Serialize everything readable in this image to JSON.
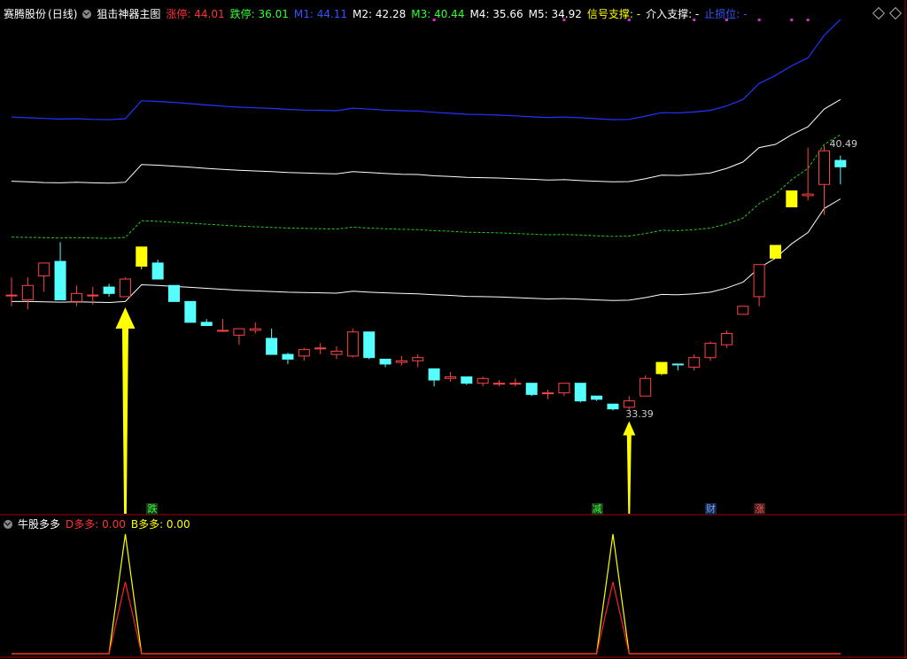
{
  "header": {
    "stock": "赛腾股份",
    "period": "(日线)",
    "indicator": "狙击神器主图",
    "items": [
      {
        "label": "涨停: 44.01",
        "color": "#ff3333"
      },
      {
        "label": "跌停: 36.01",
        "color": "#33ff33"
      },
      {
        "label": "M1: 44.11",
        "color": "#3355ff"
      },
      {
        "label": "M2: 42.28",
        "color": "#ffffff"
      },
      {
        "label": "M3: 40.44",
        "color": "#33ff33"
      },
      {
        "label": "M4: 35.66",
        "color": "#ffffff"
      },
      {
        "label": "M5: 34.92",
        "color": "#ffffff"
      },
      {
        "label": "信号支撑: -",
        "color": "#ffff00"
      },
      {
        "label": "介入支撑: -",
        "color": "#ffffff"
      },
      {
        "label": "止损位: -",
        "color": "#3355ff"
      }
    ]
  },
  "sub_header": {
    "name": "牛股多多",
    "items": [
      {
        "label": "D多多: 0.00",
        "color": "#ff3333"
      },
      {
        "label": "B多多: 0.00",
        "color": "#ffff00"
      }
    ]
  },
  "price_labels": {
    "high": "40.49",
    "low": "33.39"
  },
  "signal_tags": [
    {
      "text": "跌",
      "color": "#33ff33",
      "bg": "#1a3a1a",
      "candle": 7
    },
    {
      "text": "减",
      "color": "#33ff33",
      "bg": "#1a3a1a",
      "candle": 36
    },
    {
      "text": "财",
      "color": "#66aaff",
      "bg": "#1a2244",
      "candle": 43
    },
    {
      "text": "涨",
      "color": "#ff5555",
      "bg": "#3a1a1a",
      "candle": 46
    }
  ],
  "arrows": [
    {
      "candle": 7
    },
    {
      "candle": 38
    }
  ],
  "colors": {
    "up": "#ff4444",
    "down": "#55ffff",
    "signal": "#ffff00",
    "m1": "#2233ff",
    "band": "#ffffff",
    "m3": "#22cc22",
    "sub_b": "#ffff00",
    "sub_d": "#ff2222",
    "border": "#aa0000"
  },
  "chart_data": [
    {
      "type": "candlestick",
      "title": "狙击神器主图",
      "ylim": [
        33,
        48
      ],
      "candles": [
        {
          "o": 39.35,
          "h": 39.9,
          "l": 39.0,
          "c": 39.35
        },
        {
          "o": 39.2,
          "h": 39.9,
          "l": 38.9,
          "c": 39.65
        },
        {
          "o": 39.95,
          "h": 40.35,
          "l": 39.45,
          "c": 40.35
        },
        {
          "o": 40.4,
          "h": 41.0,
          "l": 39.2,
          "c": 39.2,
          "x": 1
        },
        {
          "o": 39.15,
          "h": 39.65,
          "l": 39.0,
          "c": 39.4
        },
        {
          "o": 39.35,
          "h": 39.6,
          "l": 39.05,
          "c": 39.35
        },
        {
          "o": 39.4,
          "h": 39.7,
          "l": 39.3,
          "c": 39.6,
          "x": 1
        },
        {
          "o": 39.3,
          "h": 39.9,
          "l": 39.3,
          "c": 39.85
        },
        {
          "o": 40.85,
          "h": 40.85,
          "l": 40.15,
          "c": 40.25,
          "y": 1
        },
        {
          "o": 40.35,
          "h": 40.45,
          "l": 39.85,
          "c": 39.85,
          "x": 1
        },
        {
          "o": 39.65,
          "h": 39.65,
          "l": 39.15,
          "c": 39.15,
          "x": 1
        },
        {
          "o": 39.15,
          "h": 39.15,
          "l": 38.5,
          "c": 38.5,
          "x": 1
        },
        {
          "o": 38.5,
          "h": 38.6,
          "l": 38.4,
          "c": 38.4,
          "x": 1
        },
        {
          "o": 38.25,
          "h": 38.6,
          "l": 38.2,
          "c": 38.25
        },
        {
          "o": 38.1,
          "h": 38.3,
          "l": 37.8,
          "c": 38.3
        },
        {
          "o": 38.3,
          "h": 38.5,
          "l": 38.15,
          "c": 38.25
        },
        {
          "o": 38.0,
          "h": 38.3,
          "l": 37.5,
          "c": 37.5,
          "x": 1
        },
        {
          "o": 37.5,
          "h": 37.55,
          "l": 37.2,
          "c": 37.35,
          "x": 1
        },
        {
          "o": 37.45,
          "h": 37.7,
          "l": 37.3,
          "c": 37.65
        },
        {
          "o": 37.7,
          "h": 37.85,
          "l": 37.5,
          "c": 37.7
        },
        {
          "o": 37.5,
          "h": 37.75,
          "l": 37.35,
          "c": 37.6
        },
        {
          "o": 37.45,
          "h": 38.3,
          "l": 37.4,
          "c": 38.2
        },
        {
          "o": 38.2,
          "h": 38.2,
          "l": 37.35,
          "c": 37.4,
          "x": 1
        },
        {
          "o": 37.35,
          "h": 37.35,
          "l": 37.1,
          "c": 37.2,
          "x": 1
        },
        {
          "o": 37.25,
          "h": 37.45,
          "l": 37.15,
          "c": 37.3
        },
        {
          "o": 37.3,
          "h": 37.5,
          "l": 37.1,
          "c": 37.4
        },
        {
          "o": 37.05,
          "h": 37.05,
          "l": 36.5,
          "c": 36.7,
          "x": 1
        },
        {
          "o": 36.75,
          "h": 36.95,
          "l": 36.65,
          "c": 36.8
        },
        {
          "o": 36.8,
          "h": 36.8,
          "l": 36.55,
          "c": 36.6,
          "x": 1
        },
        {
          "o": 36.6,
          "h": 36.8,
          "l": 36.5,
          "c": 36.75
        },
        {
          "o": 36.6,
          "h": 36.7,
          "l": 36.5,
          "c": 36.6
        },
        {
          "o": 36.6,
          "h": 36.75,
          "l": 36.5,
          "c": 36.6
        },
        {
          "o": 36.6,
          "h": 36.6,
          "l": 36.2,
          "c": 36.25,
          "x": 1
        },
        {
          "o": 36.3,
          "h": 36.4,
          "l": 36.1,
          "c": 36.3
        },
        {
          "o": 36.3,
          "h": 36.6,
          "l": 36.2,
          "c": 36.6
        },
        {
          "o": 36.6,
          "h": 36.6,
          "l": 36.0,
          "c": 36.05,
          "x": 1
        },
        {
          "o": 36.2,
          "h": 36.2,
          "l": 36.05,
          "c": 36.1,
          "x": 1
        },
        {
          "o": 35.95,
          "h": 35.95,
          "l": 35.75,
          "c": 35.8,
          "x": 1
        },
        {
          "o": 35.85,
          "h": 36.2,
          "l": 35.75,
          "c": 36.05
        },
        {
          "o": 36.2,
          "h": 36.85,
          "l": 36.2,
          "c": 36.75
        },
        {
          "o": 37.25,
          "h": 37.25,
          "l": 36.85,
          "c": 36.9,
          "y": 1
        },
        {
          "o": 37.2,
          "h": 37.2,
          "l": 37.0,
          "c": 37.2,
          "x": 1
        },
        {
          "o": 37.1,
          "h": 37.5,
          "l": 37.0,
          "c": 37.4
        },
        {
          "o": 37.4,
          "h": 37.9,
          "l": 37.3,
          "c": 37.85
        },
        {
          "o": 37.8,
          "h": 38.25,
          "l": 37.7,
          "c": 38.15
        },
        {
          "o": 38.75,
          "h": 39.0,
          "l": 38.75,
          "c": 39.0
        },
        {
          "o": 39.3,
          "h": 40.3,
          "l": 39.0,
          "c": 40.3
        },
        {
          "o": 40.9,
          "h": 40.9,
          "l": 40.5,
          "c": 40.5,
          "y": 1
        },
        {
          "o": 42.6,
          "h": 42.6,
          "l": 42.1,
          "c": 42.1,
          "y": 1
        },
        {
          "o": 42.45,
          "h": 43.95,
          "l": 42.3,
          "c": 42.5
        },
        {
          "o": 42.8,
          "h": 44.01,
          "l": 41.85,
          "c": 43.85
        },
        {
          "o": 43.55,
          "h": 43.7,
          "l": 42.8,
          "c": 43.35,
          "x": 1
        }
      ],
      "series": [
        {
          "name": "M1",
          "values": [
            44.9,
            44.88,
            44.86,
            44.84,
            44.85,
            44.83,
            44.82,
            44.85,
            45.41,
            45.39,
            45.36,
            45.32,
            45.28,
            45.24,
            45.21,
            45.19,
            45.17,
            45.14,
            45.12,
            45.11,
            45.1,
            45.18,
            45.15,
            45.12,
            45.1,
            45.09,
            45.05,
            45.02,
            44.99,
            44.98,
            44.96,
            44.94,
            44.91,
            44.89,
            44.9,
            44.88,
            44.85,
            44.82,
            44.83,
            44.93,
            45.04,
            45.03,
            45.06,
            45.11,
            45.25,
            45.45,
            45.95,
            46.2,
            46.5,
            46.75,
            47.45,
            47.95
          ]
        },
        {
          "name": "M2",
          "values": [
            42.9,
            42.88,
            42.86,
            42.85,
            42.87,
            42.85,
            42.84,
            42.87,
            43.42,
            43.4,
            43.37,
            43.34,
            43.3,
            43.27,
            43.24,
            43.22,
            43.2,
            43.17,
            43.16,
            43.14,
            43.13,
            43.2,
            43.17,
            43.14,
            43.12,
            43.11,
            43.07,
            43.05,
            43.02,
            43.01,
            43.0,
            42.98,
            42.96,
            42.94,
            42.95,
            42.92,
            42.9,
            42.88,
            42.89,
            42.98,
            43.09,
            43.08,
            43.11,
            43.16,
            43.3,
            43.5,
            43.95,
            44.05,
            44.35,
            44.6,
            45.15,
            45.45
          ]
        },
        {
          "name": "M3",
          "values": [
            41.16,
            41.15,
            41.14,
            41.13,
            41.14,
            41.13,
            41.12,
            41.15,
            41.67,
            41.65,
            41.62,
            41.59,
            41.56,
            41.53,
            41.5,
            41.48,
            41.46,
            41.44,
            41.43,
            41.42,
            41.41,
            41.47,
            41.44,
            41.42,
            41.4,
            41.39,
            41.36,
            41.34,
            41.31,
            41.3,
            41.29,
            41.27,
            41.25,
            41.23,
            41.24,
            41.22,
            41.2,
            41.18,
            41.19,
            41.27,
            41.37,
            41.36,
            41.39,
            41.44,
            41.57,
            41.75,
            42.2,
            42.5,
            42.95,
            43.3,
            44.05,
            44.35
          ]
        },
        {
          "name": "M4",
          "values": [
            39.15,
            39.15,
            39.14,
            39.13,
            39.14,
            39.13,
            39.12,
            39.15,
            39.67,
            39.65,
            39.62,
            39.59,
            39.56,
            39.53,
            39.5,
            39.48,
            39.46,
            39.44,
            39.43,
            39.42,
            39.41,
            39.47,
            39.44,
            39.42,
            39.4,
            39.39,
            39.36,
            39.34,
            39.31,
            39.3,
            39.29,
            39.27,
            39.25,
            39.23,
            39.24,
            39.22,
            39.2,
            39.18,
            39.19,
            39.27,
            39.37,
            39.36,
            39.39,
            39.44,
            39.57,
            39.75,
            40.2,
            40.5,
            40.95,
            41.3,
            42.05,
            42.35
          ]
        },
        {
          "name": "M5",
          "values": [
            38.8,
            38.8,
            38.79,
            38.78,
            38.79,
            38.78,
            38.77,
            38.8,
            39.32,
            39.3,
            39.27,
            39.24,
            39.21,
            39.18,
            39.15,
            39.13,
            39.11,
            39.09,
            39.08,
            39.07,
            39.06,
            39.12,
            39.09,
            39.07,
            39.05,
            39.04,
            39.01,
            38.99,
            38.96,
            38.95,
            38.94,
            38.92,
            38.9,
            38.88,
            38.89,
            38.87,
            38.85,
            38.83,
            38.84,
            38.92,
            39.02,
            39.01,
            39.04,
            39.09,
            39.22,
            39.4,
            39.85,
            40.15,
            40.6,
            40.95,
            41.7,
            42.0
          ]
        }
      ]
    },
    {
      "type": "line",
      "title": "牛股多多",
      "ylim": [
        0,
        1
      ],
      "series": [
        {
          "name": "B多多",
          "values": [
            0,
            0,
            0,
            0,
            0,
            0,
            0,
            1,
            0,
            0,
            0,
            0,
            0,
            0,
            0,
            0,
            0,
            0,
            0,
            0,
            0,
            0,
            0,
            0,
            0,
            0,
            0,
            0,
            0,
            0,
            0,
            0,
            0,
            0,
            0,
            0,
            0,
            1,
            0,
            0,
            0,
            0,
            0,
            0,
            0,
            0,
            0,
            0,
            0,
            0,
            0,
            0
          ]
        },
        {
          "name": "D多多",
          "values": [
            0,
            0,
            0,
            0,
            0,
            0,
            0,
            0.6,
            0,
            0,
            0,
            0,
            0,
            0,
            0,
            0,
            0,
            0,
            0,
            0,
            0,
            0,
            0,
            0,
            0,
            0,
            0,
            0,
            0,
            0,
            0,
            0,
            0,
            0,
            0,
            0,
            0,
            0.6,
            0,
            0,
            0,
            0,
            0,
            0,
            0,
            0,
            0,
            0,
            0,
            0,
            0,
            0
          ]
        }
      ]
    }
  ]
}
